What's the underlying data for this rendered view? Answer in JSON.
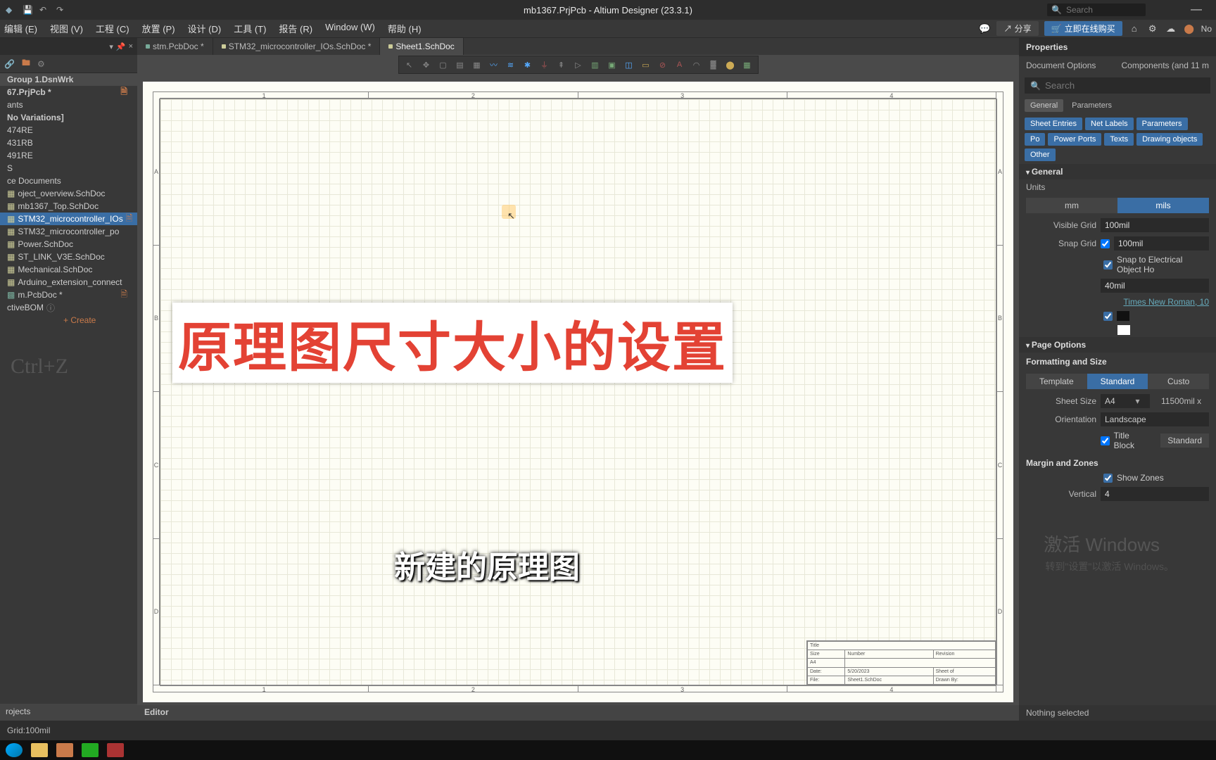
{
  "titlebar": {
    "title": "mb1367.PrjPcb - Altium Designer (23.3.1)",
    "search_placeholder": "Search"
  },
  "menubar": {
    "items": [
      "编辑 (E)",
      "视图 (V)",
      "工程 (C)",
      "放置 (P)",
      "设计 (D)",
      "工具 (T)",
      "报告 (R)",
      "Window (W)",
      "帮助 (H)"
    ],
    "share": "分享",
    "buy": "立即在线购买",
    "notif": "No"
  },
  "left": {
    "workspace": "Group 1.DsnWrk",
    "project": "67.PrjPcb *",
    "nodes": [
      "ants",
      "No Variations]",
      "474RE",
      "431RB",
      "491RE",
      "S",
      "ce Documents",
      "oject_overview.SchDoc",
      "mb1367_Top.SchDoc"
    ],
    "selected": "STM32_microcontroller_IOs",
    "after": [
      "STM32_microcontroller_po",
      "Power.SchDoc",
      "ST_LINK_V3E.SchDoc",
      "Mechanical.SchDoc",
      "Arduino_extension_connect",
      "m.PcbDoc *",
      "ctiveBOM"
    ],
    "create": "+ Create",
    "hint": "Ctrl+Z",
    "bottom_tab": "rojects"
  },
  "tabs": [
    {
      "label": "stm.PcbDoc *",
      "active": false,
      "green": true
    },
    {
      "label": "STM32_microcontroller_IOs.SchDoc *",
      "active": false,
      "green": false
    },
    {
      "label": "Sheet1.SchDoc",
      "active": true,
      "green": false
    }
  ],
  "zones_h": [
    "1",
    "2",
    "3",
    "4"
  ],
  "zones_v": [
    "A",
    "B",
    "C",
    "D"
  ],
  "title_block": {
    "title": "Title",
    "size": "Size",
    "number": "Number",
    "rev": "Revision",
    "a4": "A4",
    "date_l": "Date:",
    "date_v": "5/20/2023",
    "sheet": "Sheet   of",
    "file_l": "File:",
    "file_v": "Sheet1.SchDoc",
    "drawn": "Drawn By:"
  },
  "editor_label": "Editor",
  "right": {
    "header": "Properties",
    "doc_opts": "Document Options",
    "comps": "Components (and 11 m",
    "search": "Search",
    "tab_general": "General",
    "tab_params": "Parameters",
    "pills": [
      "Sheet Entries",
      "Net Labels",
      "Parameters",
      "Po",
      "Power Ports",
      "Texts",
      "Drawing objects",
      "Other"
    ],
    "sec_general": "General",
    "units_label": "Units",
    "unit_mm": "mm",
    "unit_mils": "mils",
    "vis_grid_l": "Visible Grid",
    "vis_grid_v": "100mil",
    "snap_grid_l": "Snap Grid",
    "snap_grid_v": "100mil",
    "snap_elec": "Snap to Electrical Object Ho",
    "snap_dist_v": "40mil",
    "font_v": "Times New Roman, 10",
    "sec_page": "Page Options",
    "fmt_size": "Formatting and Size",
    "seg_template": "Template",
    "seg_standard": "Standard",
    "seg_custom": "Custo",
    "sheet_size_l": "Sheet Size",
    "sheet_size_v": "A4",
    "sheet_dims": "11500mil  x",
    "orient_l": "Orientation",
    "orient_v": "Landscape",
    "titleblk_l": "Title Block",
    "titleblk_v": "Standard",
    "sec_margin": "Margin and Zones",
    "show_zones": "Show Zones",
    "vertical_l": "Vertical",
    "vertical_v": "4",
    "nothing": "Nothing selected"
  },
  "status": {
    "grid": "Grid:100mil"
  },
  "overlay": {
    "red_text": "原理图尺寸大小的设置",
    "sub_text": "新建的原理图",
    "wm1": "激活 Windows",
    "wm2": "转到\"设置\"以激活 Windows。"
  }
}
